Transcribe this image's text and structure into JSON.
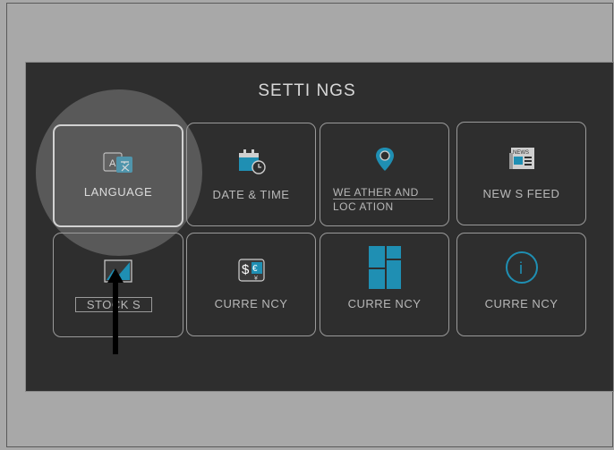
{
  "settings": {
    "title": "SETTI NGS",
    "tiles": [
      {
        "label": "LANGUAGE",
        "icon": "language-icon",
        "active": true
      },
      {
        "label": "DATE & TIME",
        "icon": "calendar-clock-icon"
      },
      {
        "label_line1": "WE ATHER AND",
        "label_line2": "LOC ATION",
        "icon": "location-pin-icon"
      },
      {
        "label": "NEW S FEED",
        "icon": "newspaper-icon",
        "icon_text": "NEWS"
      },
      {
        "label": "STOCK S",
        "icon": "stocks-chart-icon"
      },
      {
        "label": "CURRE NCY",
        "icon": "currency-exchange-icon",
        "icon_text_left": "$",
        "icon_text_right": "€",
        "icon_text_small": "¥"
      },
      {
        "label": "CURRE NCY",
        "icon": "tiles-layout-icon"
      },
      {
        "label": "CURRE NCY",
        "icon": "info-icon",
        "icon_text": "i"
      }
    ],
    "language_icon_text": "A"
  },
  "colors": {
    "accent": "#1f8fb3",
    "panel_bg": "#2e2e2e",
    "page_bg": "#a8a8a8",
    "tile_border": "#9a9a9a"
  }
}
